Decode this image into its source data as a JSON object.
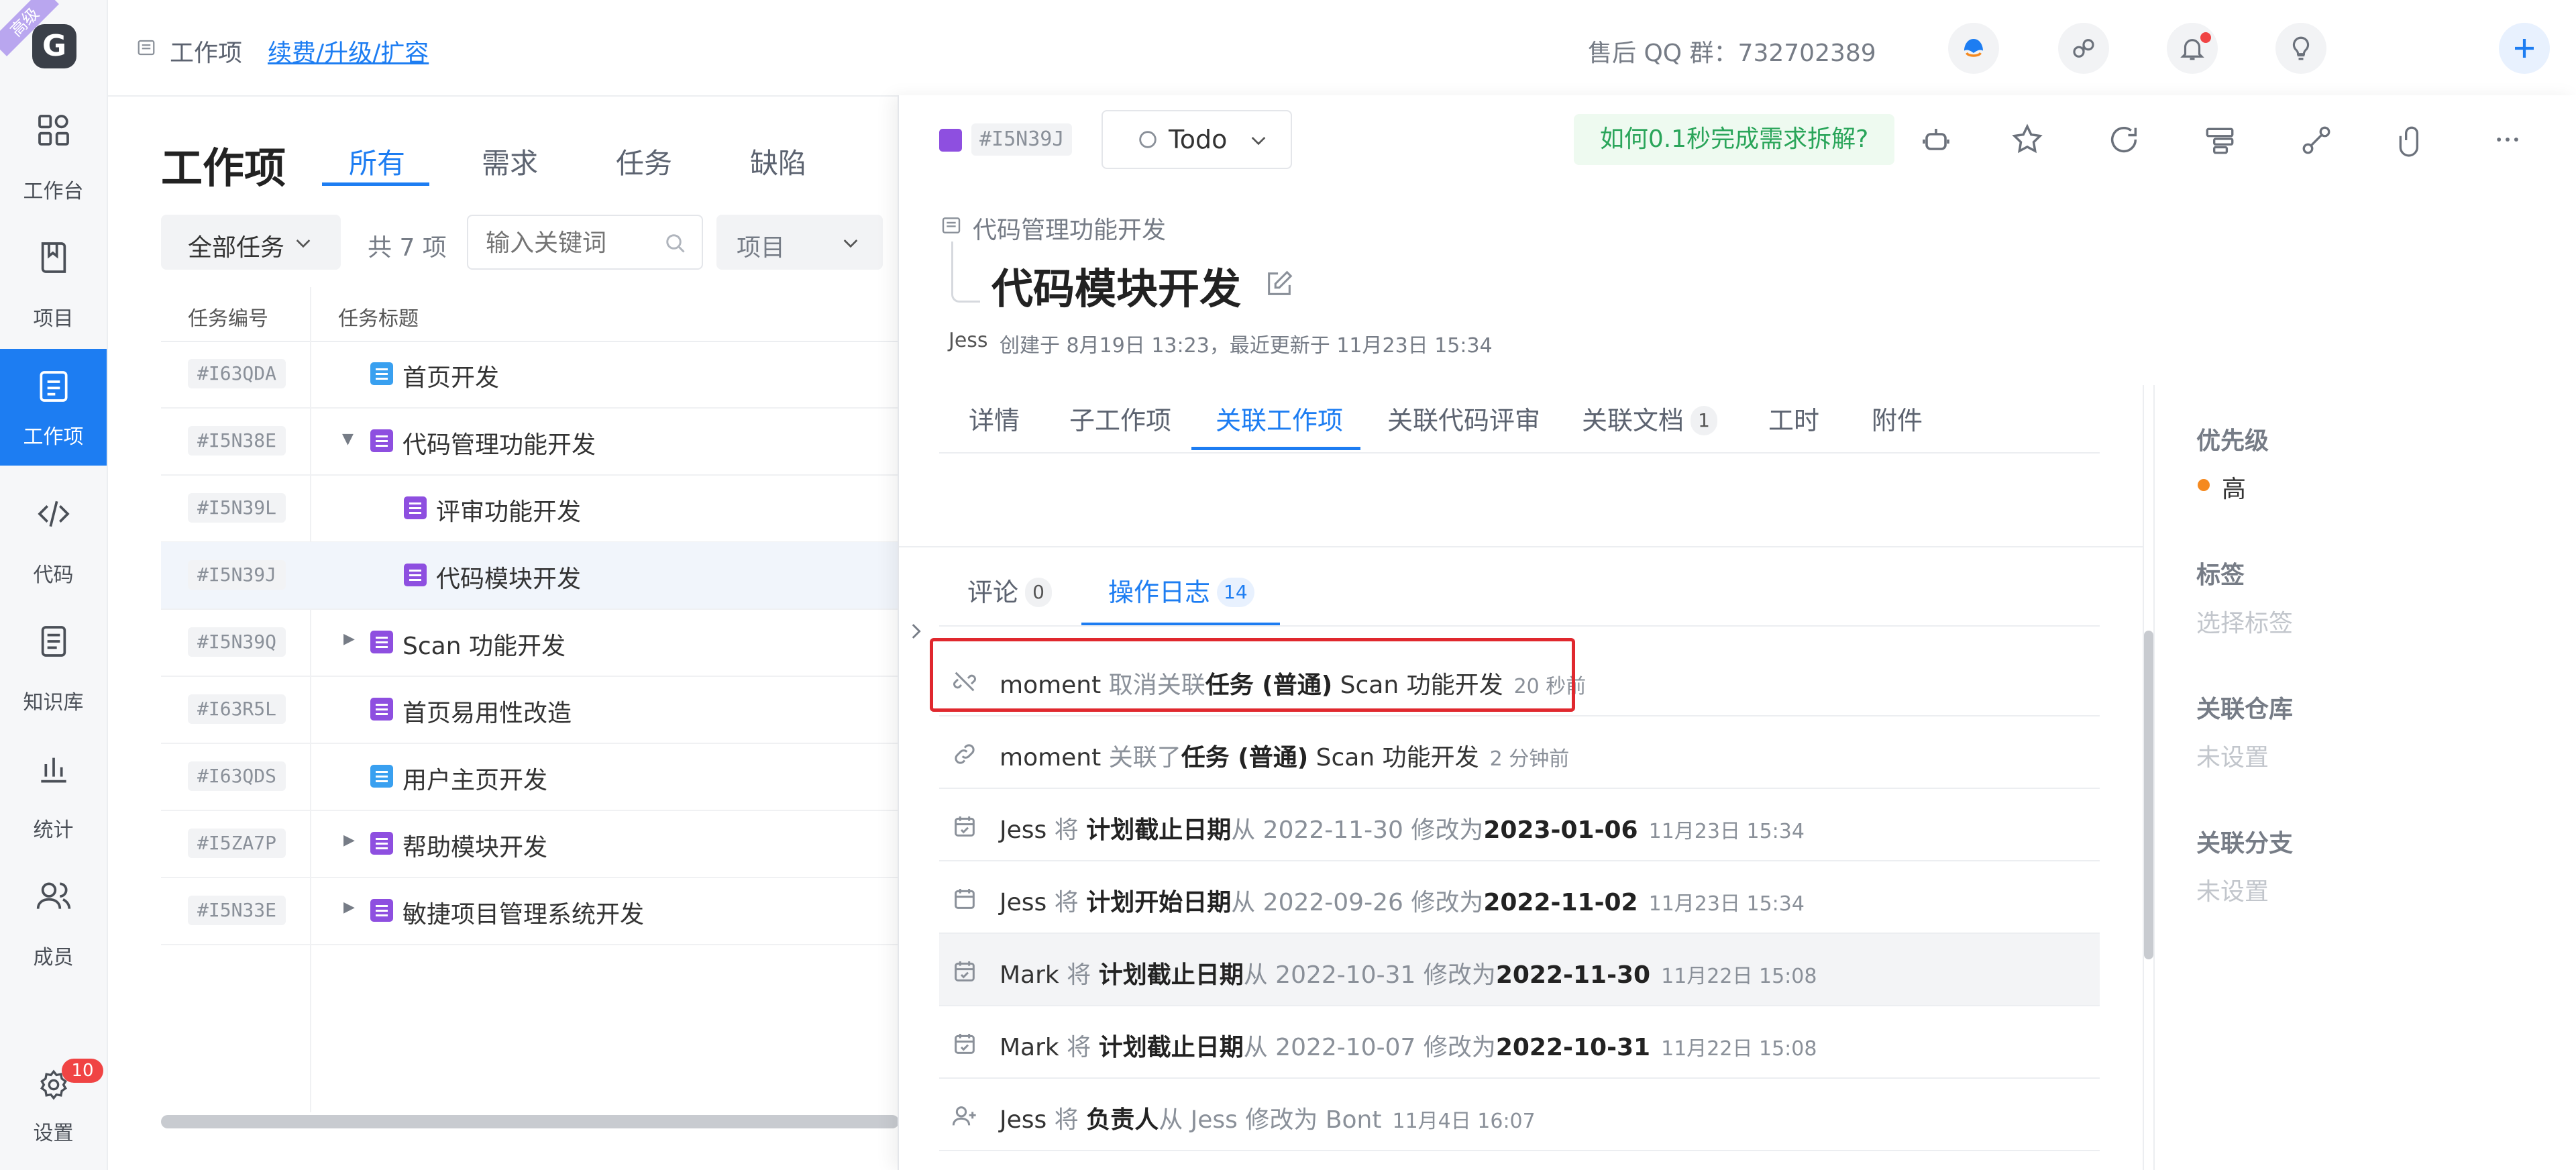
{
  "rail": {
    "logo_letter": "G",
    "badge": "高级",
    "items": [
      {
        "label": "工作台",
        "icon": "dashboard-icon"
      },
      {
        "label": "项目",
        "icon": "book-icon"
      },
      {
        "label": "工作项",
        "icon": "task-list-icon",
        "active": true
      },
      {
        "label": "代码",
        "icon": "code-icon"
      },
      {
        "label": "知识库",
        "icon": "document-icon"
      },
      {
        "label": "统计",
        "icon": "bar-chart-icon"
      },
      {
        "label": "成员",
        "icon": "people-icon"
      }
    ],
    "settings": {
      "label": "设置",
      "badge": "10"
    }
  },
  "topbar": {
    "breadcrumb": "工作项",
    "renew_link": "续费/升级/扩容",
    "qq_group": "售后 QQ 群：732702389"
  },
  "list": {
    "title": "工作项",
    "tabs": [
      "所有",
      "需求",
      "任务",
      "缺陷"
    ],
    "filter_scope": "全部任务",
    "total": "共 7 项",
    "search_placeholder": "输入关键词",
    "project_filter": "项目",
    "columns": [
      "任务编号",
      "任务标题"
    ],
    "rows": [
      {
        "code": "#I63QDA",
        "title": "首页开发",
        "icon": "blue"
      },
      {
        "code": "#I5N38E",
        "title": "代码管理功能开发",
        "icon": "purple",
        "arrow": "▼"
      },
      {
        "code": "#I5N39L",
        "title": "评审功能开发",
        "icon": "purple"
      },
      {
        "code": "#I5N39J",
        "title": "代码模块开发",
        "icon": "purple",
        "selected": true
      },
      {
        "code": "#I5N39Q",
        "title": "Scan 功能开发",
        "icon": "purple",
        "arrow": "▶"
      },
      {
        "code": "#I63R5L",
        "title": "首页易用性改造",
        "icon": "purple"
      },
      {
        "code": "#I63QDS",
        "title": "用户主页开发",
        "icon": "blue"
      },
      {
        "code": "#I5ZA7P",
        "title": "帮助模块开发",
        "icon": "purple",
        "arrow": "▶"
      },
      {
        "code": "#I5N33E",
        "title": "敏捷项目管理系统开发",
        "icon": "purple",
        "arrow": "▶"
      }
    ]
  },
  "detail": {
    "code": "#I5N39J",
    "status": "Todo",
    "promo": "如何0.1秒完成需求拆解?",
    "parent": "代码管理功能开发",
    "title": "代码模块开发",
    "author": "Jess",
    "meta": "创建于 8月19日 13:23，最近更新于 11月23日 15:34",
    "tabs": [
      "详情",
      "子工作项",
      "关联工作项",
      "关联代码评审",
      "关联文档",
      "工时",
      "附件"
    ],
    "doc_count": "1",
    "subtabs": {
      "comments": "评论",
      "comments_count": "0",
      "log": "操作日志",
      "log_count": "14"
    },
    "logs": [
      {
        "icon": "unlink-icon",
        "user": "moment",
        "parts": [
          {
            "t": "取消关联",
            "s": "muted"
          },
          {
            "t": "任务 (普通)",
            "s": "b"
          },
          {
            "t": "Scan 功能开发",
            "s": ""
          }
        ],
        "time": "20 秒前",
        "highlight": true
      },
      {
        "icon": "link-icon",
        "user": "moment",
        "parts": [
          {
            "t": "关联了",
            "s": "muted"
          },
          {
            "t": "任务 (普通)",
            "s": "b"
          },
          {
            "t": "Scan 功能开发",
            "s": ""
          }
        ],
        "time": "2 分钟前"
      },
      {
        "icon": "calendar-check-icon",
        "user": "Jess",
        "parts": [
          {
            "t": "将",
            "s": "muted"
          },
          {
            "t": "计划截止日期",
            "s": "b"
          },
          {
            "t": "从 2022-11-30 修改为",
            "s": "muted"
          },
          {
            "t": "2023-01-06",
            "s": "b"
          }
        ],
        "time": "11月23日 15:34"
      },
      {
        "icon": "calendar-icon",
        "user": "Jess",
        "parts": [
          {
            "t": "将",
            "s": "muted"
          },
          {
            "t": "计划开始日期",
            "s": "b"
          },
          {
            "t": "从 2022-09-26 修改为",
            "s": "muted"
          },
          {
            "t": "2022-11-02",
            "s": "b"
          }
        ],
        "time": "11月23日 15:34"
      },
      {
        "icon": "calendar-check-icon",
        "user": "Mark",
        "parts": [
          {
            "t": "将",
            "s": "muted"
          },
          {
            "t": "计划截止日期",
            "s": "b"
          },
          {
            "t": "从 2022-10-31 修改为",
            "s": "muted"
          },
          {
            "t": "2022-11-30",
            "s": "b"
          }
        ],
        "time": "11月22日 15:08",
        "hover": true
      },
      {
        "icon": "calendar-check-icon",
        "user": "Mark",
        "parts": [
          {
            "t": "将",
            "s": "muted"
          },
          {
            "t": "计划截止日期",
            "s": "b"
          },
          {
            "t": "从 2022-10-07 修改为",
            "s": "muted"
          },
          {
            "t": "2022-10-31",
            "s": "b"
          }
        ],
        "time": "11月22日 15:08"
      },
      {
        "icon": "user-plus-icon",
        "user": "Jess",
        "parts": [
          {
            "t": "将",
            "s": "muted"
          },
          {
            "t": "负责人",
            "s": "b"
          },
          {
            "t": "从 Jess 修改为 Bont",
            "s": "muted"
          }
        ],
        "time": "11月4日 16:07"
      }
    ],
    "side": {
      "priority_label": "优先级",
      "priority_value": "高",
      "tags_label": "标签",
      "tags_value": "选择标签",
      "repo_label": "关联仓库",
      "repo_value": "未设置",
      "branch_label": "关联分支",
      "branch_value": "未设置"
    }
  },
  "colors": {
    "accent": "#1d7df2",
    "purple": "#8e4fe0",
    "highlight_border": "#e0282e",
    "priority": "#f5891f"
  }
}
